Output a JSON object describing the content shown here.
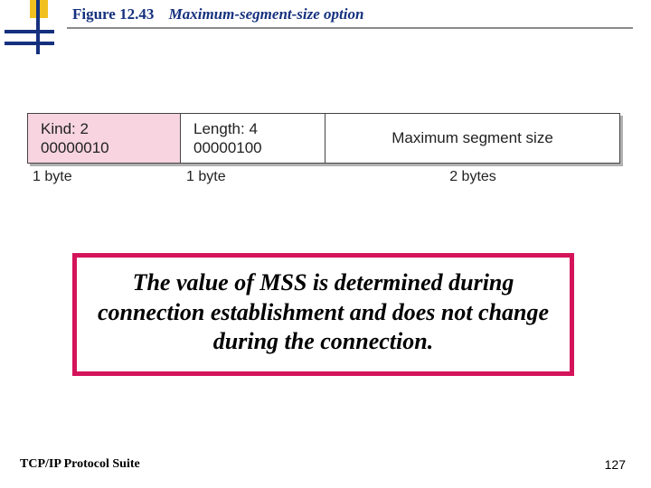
{
  "figure": {
    "number": "Figure 12.43",
    "title": "Maximum-segment-size option"
  },
  "fields": {
    "kind": {
      "label": "Kind: 2",
      "bits": "00000010",
      "size": "1 byte"
    },
    "length": {
      "label": "Length: 4",
      "bits": "00000100",
      "size": "1 byte"
    },
    "mss": {
      "label": "Maximum segment size",
      "size": "2 bytes"
    }
  },
  "callout": "The value of MSS is determined during connection establishment and does not change during the connection.",
  "footer": {
    "source": "TCP/IP Protocol Suite",
    "page": "127"
  }
}
